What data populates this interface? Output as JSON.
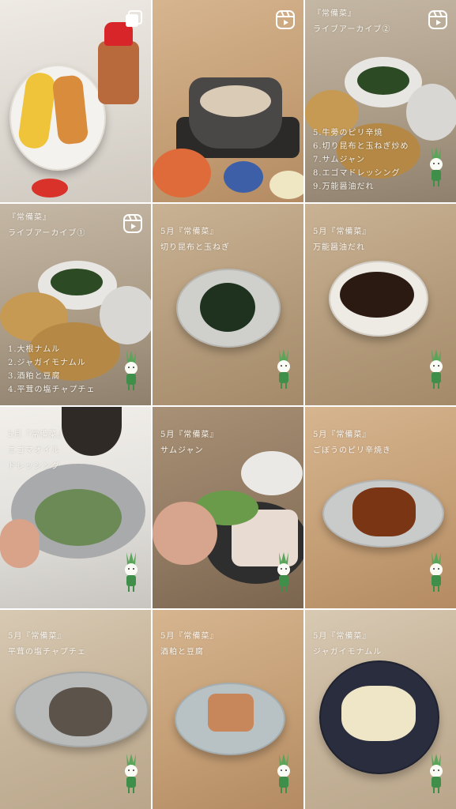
{
  "tiles": [
    {
      "type": "carousel",
      "icon": "multi-photo-icon",
      "captions": []
    },
    {
      "type": "reel",
      "icon": "reel-icon",
      "captions": []
    },
    {
      "type": "reel",
      "icon": "reel-icon",
      "captions": [
        "『常備菜』",
        "ライブアーカイブ②"
      ],
      "list": [
        "5.牛蒡のピリ辛焼",
        "6.切り昆布と玉ねぎ炒め",
        "7.サムジャン",
        "8.エゴマドレッシング",
        "9.万能醤油だれ"
      ]
    },
    {
      "type": "reel",
      "icon": "reel-icon",
      "captions": [
        "『常備菜』",
        "ライブアーカイブ①"
      ],
      "list": [
        "1.大根ナムル",
        "2.ジャガイモナムル",
        "3.酒粕と豆腐",
        "4.平茸の塩チャプチェ"
      ]
    },
    {
      "type": "post",
      "captions": [
        "5月『常備菜』",
        "切り昆布と玉ねぎ"
      ]
    },
    {
      "type": "post",
      "captions": [
        "5月『常備菜』",
        "万能醤油だれ"
      ]
    },
    {
      "type": "post",
      "captions": [
        "5月『常備菜』",
        "エゴマオイル",
        "ドレッシング"
      ]
    },
    {
      "type": "post",
      "captions": [
        "5月『常備菜』",
        "サムジャン"
      ]
    },
    {
      "type": "post",
      "captions": [
        "5月『常備菜』",
        "ごぼうのピリ辛焼き"
      ]
    },
    {
      "type": "post",
      "captions": [
        "5月『常備菜』",
        "平茸の塩チャプチェ"
      ]
    },
    {
      "type": "post",
      "captions": [
        "5月『常備菜』",
        "酒粕と豆腐"
      ]
    },
    {
      "type": "post",
      "captions": [
        "5月『常備菜』",
        "ジャガイモナムル"
      ]
    }
  ],
  "colors": {
    "caption": "#faf6ef",
    "mascot_green": "#3f8f4a",
    "background": "#ffffff"
  }
}
